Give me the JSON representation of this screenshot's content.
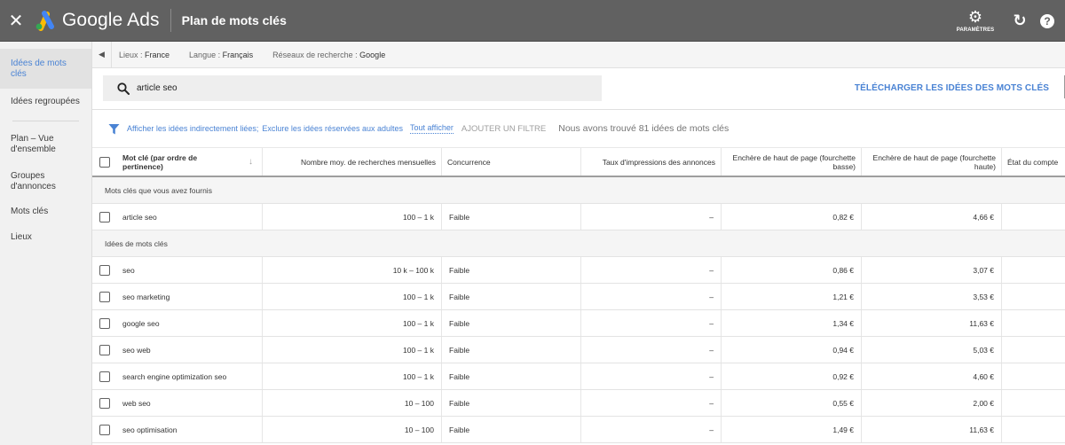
{
  "topbar": {
    "close_icon": "close-icon",
    "brand": "Google Ads",
    "title": "Plan de mots clés",
    "settings_label": "PARAMÈTRES",
    "settings_icon": "gear-icon",
    "refresh_icon": "refresh-icon",
    "help_icon": "help-icon"
  },
  "colors": {
    "topbar_bg": "#616161",
    "accent": "#4a83d4",
    "sidebar_bg": "#f1f1f1"
  },
  "sidebar": {
    "items": [
      {
        "label": "Idées de mots clés",
        "active": true
      },
      {
        "label": "Idées regroupées",
        "active": false
      },
      {
        "label": "Plan – Vue d'ensemble",
        "active": false
      },
      {
        "label": "Groupes d'annonces",
        "active": false
      },
      {
        "label": "Mots clés",
        "active": false
      },
      {
        "label": "Lieux",
        "active": false
      }
    ]
  },
  "context": {
    "locations_label": "Lieux : ",
    "locations_value": "France",
    "language_label": "Langue : ",
    "language_value": "Français",
    "network_label": "Réseaux de recherche : ",
    "network_value": "Google"
  },
  "search": {
    "value": "article seo",
    "download_label": "TÉLÉCHARGER LES IDÉES DES MOTS CLÉS"
  },
  "filters": {
    "filter1": "Afficher les idées indirectement liées;",
    "filter2": "Exclure les idées réservées aux adultes",
    "show_all": "Tout afficher",
    "add_filter": "AJOUTER UN FILTRE",
    "result_count": "Nous avons trouvé 81 idées de mots clés"
  },
  "table": {
    "headers": {
      "keyword": "Mot clé (par ordre de pertinence)",
      "avg_searches": "Nombre moy. de recherches mensuelles",
      "competition": "Concurrence",
      "impression_share": "Taux d'impressions des annonces",
      "bid_low": "Enchère de haut de page (fourchette basse)",
      "bid_high": "Enchère de haut de page (fourchette haute)",
      "account_status": "État du compte"
    },
    "group1_label": "Mots clés que vous avez fournis",
    "provided": [
      {
        "keyword": "article seo",
        "searches": "100 – 1 k",
        "competition": "Faible",
        "impr": "–",
        "low": "0,82 €",
        "high": "4,66 €",
        "status": ""
      }
    ],
    "group2_label": "Idées de mots clés",
    "ideas": [
      {
        "keyword": "seo",
        "searches": "10 k – 100 k",
        "competition": "Faible",
        "impr": "–",
        "low": "0,86 €",
        "high": "3,07 €",
        "status": ""
      },
      {
        "keyword": "seo marketing",
        "searches": "100 – 1 k",
        "competition": "Faible",
        "impr": "–",
        "low": "1,21 €",
        "high": "3,53 €",
        "status": ""
      },
      {
        "keyword": "google seo",
        "searches": "100 – 1 k",
        "competition": "Faible",
        "impr": "–",
        "low": "1,34 €",
        "high": "11,63 €",
        "status": ""
      },
      {
        "keyword": "seo web",
        "searches": "100 – 1 k",
        "competition": "Faible",
        "impr": "–",
        "low": "0,94 €",
        "high": "5,03 €",
        "status": ""
      },
      {
        "keyword": "search engine optimization seo",
        "searches": "100 – 1 k",
        "competition": "Faible",
        "impr": "–",
        "low": "0,92 €",
        "high": "4,60 €",
        "status": ""
      },
      {
        "keyword": "web seo",
        "searches": "10 – 100",
        "competition": "Faible",
        "impr": "–",
        "low": "0,55 €",
        "high": "2,00 €",
        "status": ""
      },
      {
        "keyword": "seo optimisation",
        "searches": "10 – 100",
        "competition": "Faible",
        "impr": "–",
        "low": "1,49 €",
        "high": "11,63 €",
        "status": ""
      }
    ]
  }
}
